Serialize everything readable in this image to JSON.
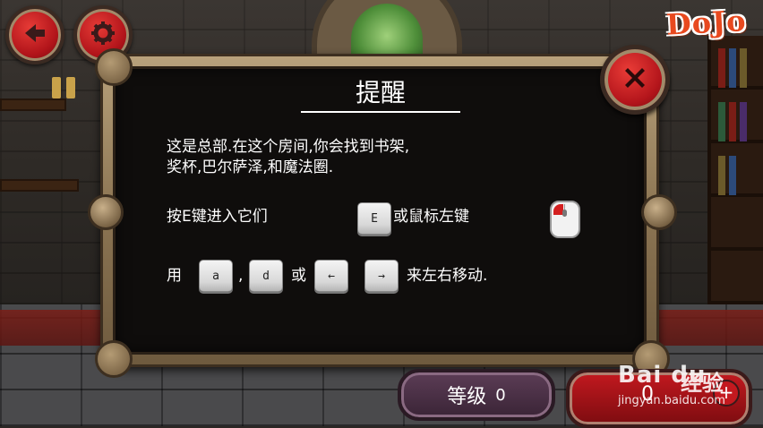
{
  "hud": {
    "back_icon": "back-arrow-icon",
    "settings_icon": "gear-icon",
    "logo_text": "DoJo"
  },
  "dialog": {
    "title": "提醒",
    "line1": "这是总部.在这个房间,你会找到书架,",
    "line2": "奖杯,巴尔萨泽,和魔法圈.",
    "enter_label": "按E键进入它们",
    "enter_key": "E",
    "mouse_label": "或鼠标左键",
    "mouse_icon": "mouse-left-click-icon",
    "move_prefix": "用",
    "key_a": "a",
    "comma": ",",
    "key_d": "d",
    "or_label": "或",
    "key_left": "←",
    "key_right": "→",
    "move_suffix": "来左右移动.",
    "close_icon": "close-x-icon"
  },
  "bottom": {
    "level_label": "等级",
    "level_value": "0",
    "currency_value": "0",
    "plus_label": "+"
  },
  "watermark": {
    "brand": "Bai du",
    "sub": "经验",
    "url": "jingyan.baidu.com"
  },
  "colors": {
    "accent_red": "#c3191f",
    "dialog_bg": "#0f0d0c",
    "frame_gold": "#8c7553",
    "text_white": "#ffffff"
  }
}
